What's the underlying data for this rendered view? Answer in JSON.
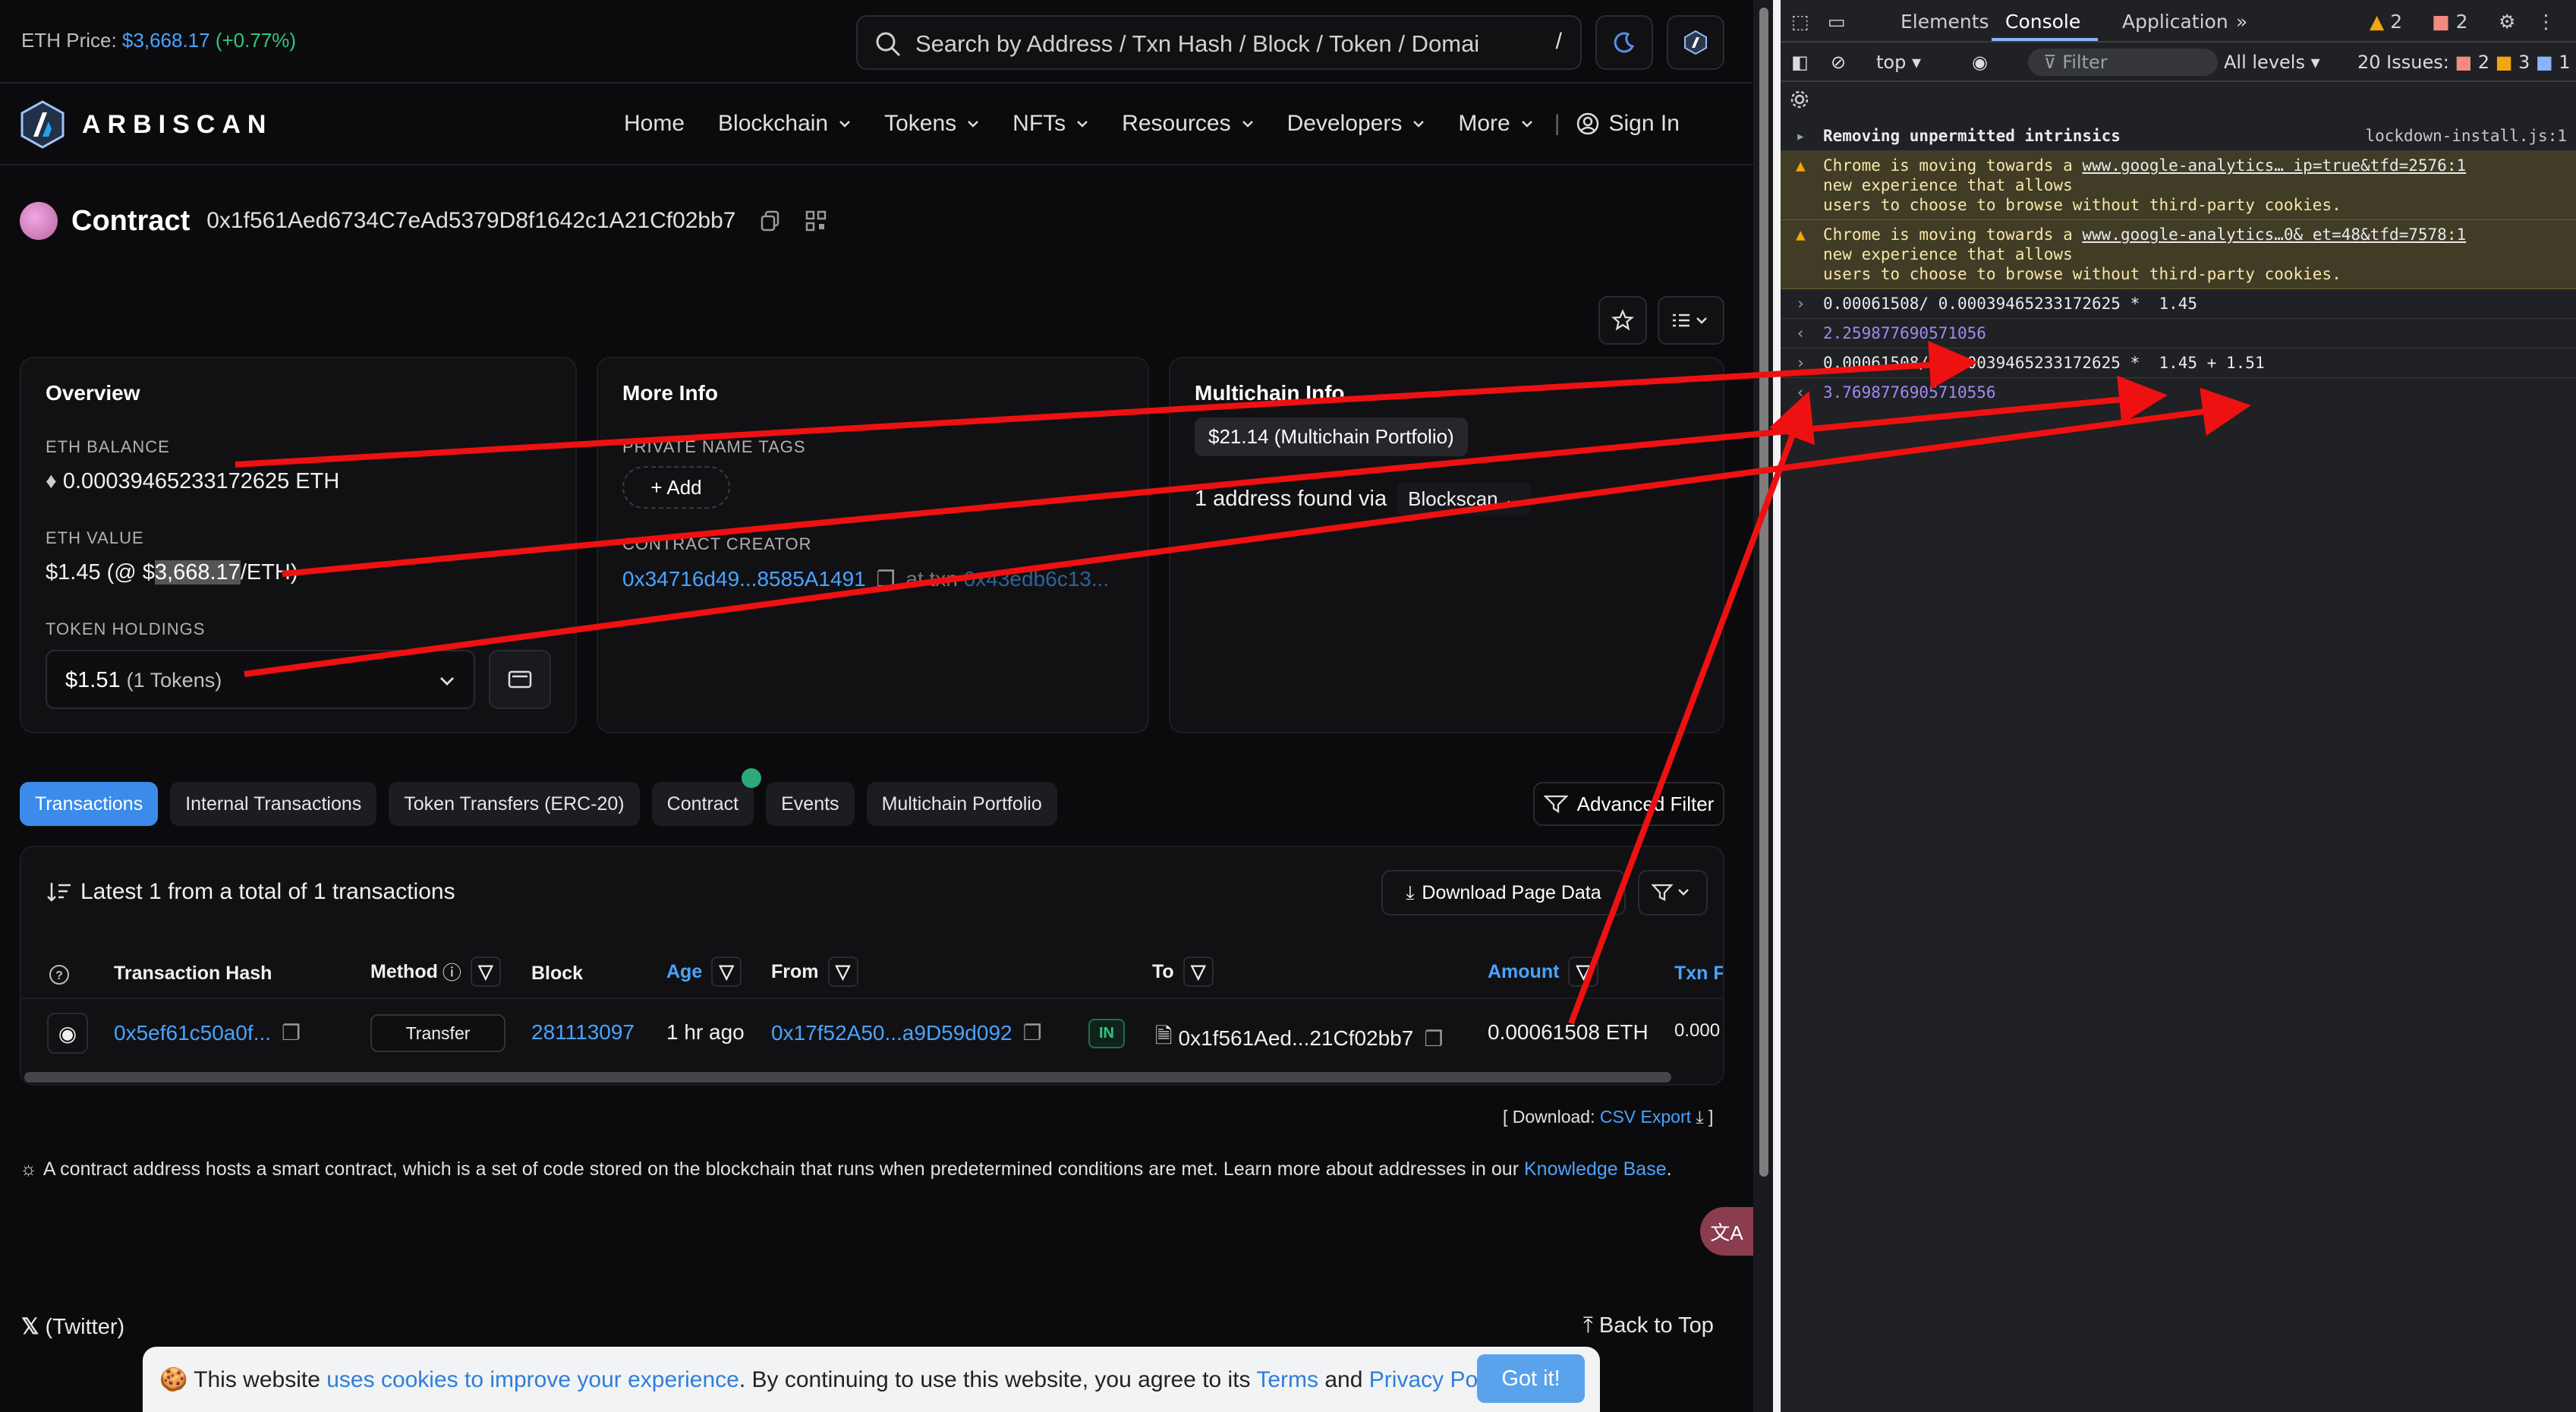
{
  "topbar": {
    "eth_price_label": "ETH Price:",
    "eth_price_value": "$3,668.17",
    "eth_price_change": "(+0.77%)",
    "search_placeholder": "Search by Address / Txn Hash / Block / Token / Domai",
    "search_shortcut": "/"
  },
  "nav": {
    "logo_text": "ARBISCAN",
    "items": [
      "Home",
      "Blockchain",
      "Tokens",
      "NFTs",
      "Resources",
      "Developers",
      "More"
    ],
    "sign_in": "Sign In"
  },
  "contract": {
    "heading": "Contract",
    "address": "0x1f561Aed6734C7eAd5379D8f1642c1A21Cf02bb7"
  },
  "overview": {
    "title": "Overview",
    "eth_balance_label": "ETH BALANCE",
    "eth_balance_value": "0.00039465233172625 ETH",
    "eth_value_label": "ETH VALUE",
    "eth_value_prefix": "$1.45 (@ $",
    "eth_value_highlight": "3,668.17",
    "eth_value_suffix": "/ETH)",
    "token_holdings_label": "TOKEN HOLDINGS",
    "token_holdings_value": "$1.51",
    "token_holdings_count": "(1 Tokens)"
  },
  "more_info": {
    "title": "More Info",
    "private_tags_label": "PRIVATE NAME TAGS",
    "add_label": "+ Add",
    "creator_label": "CONTRACT CREATOR",
    "creator_address": "0x34716d49...8585A1491",
    "creator_txn_prefix": "at txn",
    "creator_txn": "0x43edb6c13..."
  },
  "multichain": {
    "title": "Multichain Info",
    "portfolio_badge": "$21.14 (Multichain Portfolio)",
    "found_text": "1 address found via",
    "found_source": "Blockscan"
  },
  "tabs": [
    "Transactions",
    "Internal Transactions",
    "Token Transfers (ERC-20)",
    "Contract",
    "Events",
    "Multichain Portfolio"
  ],
  "advanced_filter": "Advanced Filter",
  "txn_table": {
    "summary": "Latest 1 from a total of 1 transactions",
    "download": "Download Page Data",
    "headers": {
      "hash": "Transaction Hash",
      "method": "Method",
      "block": "Block",
      "age": "Age",
      "from": "From",
      "to": "To",
      "amount": "Amount",
      "fee": "Txn Fe"
    },
    "row": {
      "hash": "0x5ef61c50a0f...",
      "method": "Transfer",
      "block": "281113097",
      "age": "1 hr ago",
      "from": "0x17f52A50...a9D59d092",
      "direction": "IN",
      "to": "0x1f561Aed...21Cf02bb7",
      "amount": "0.00061508 ETH",
      "fee": "0.000"
    }
  },
  "csv_export": {
    "prefix": "[ Download:",
    "link": "CSV Export",
    "suffix": "]"
  },
  "info_line": {
    "text": "A contract address hosts a smart contract, which is a set of code stored on the blockchain that runs when predetermined conditions are met. Learn more about addresses in our",
    "link": "Knowledge Base",
    "end": "."
  },
  "footer": {
    "twitter": "(Twitter)",
    "back_to_top": "Back to Top"
  },
  "cookie": {
    "text1": "This website",
    "link1": "uses cookies to improve your experience",
    "text2": ". By continuing to use this website, you agree to its",
    "link2": "Terms",
    "text3": "and",
    "link3": "Privacy Policy",
    "text4": ".",
    "button": "Got it!"
  },
  "devtools": {
    "tabs": [
      "Elements",
      "Console",
      "Application"
    ],
    "warn_count": "2",
    "error_count": "2",
    "context": "top",
    "filter_placeholder": "Filter",
    "levels": "All levels",
    "issues_label": "20 Issues:",
    "issues_err": "2",
    "issues_warn": "3",
    "issues_info": "1",
    "console": {
      "line1": "Removing unpermitted intrinsics",
      "line1_src": "lockdown-install.js:1",
      "warn1_a": "Chrome is moving towards a",
      "warn1_src": "www.google-analytics… ip=true&tfd=2576:1",
      "warn1_b": "new experience that allows",
      "warn1_c": "users to choose to browse without third-party cookies.",
      "warn2_a": "Chrome is moving towards a",
      "warn2_src": "www.google-analytics…0& et=48&tfd=7578:1",
      "warn2_b": "new experience that allows",
      "warn2_c": "users to choose to browse without third-party cookies.",
      "input1": "0.00061508/ 0.00039465233172625 *  1.45",
      "result1": "2.259877690571056",
      "input2": "0.00061508/ 0.00039465233172625 *  1.45 + 1.51",
      "result2": "3.7698776905710556"
    }
  },
  "colors": {
    "link": "#4aa3ff",
    "positive": "#2fc77f",
    "tab_active": "#3a8bea",
    "annotation_arrow": "#ee1111"
  }
}
